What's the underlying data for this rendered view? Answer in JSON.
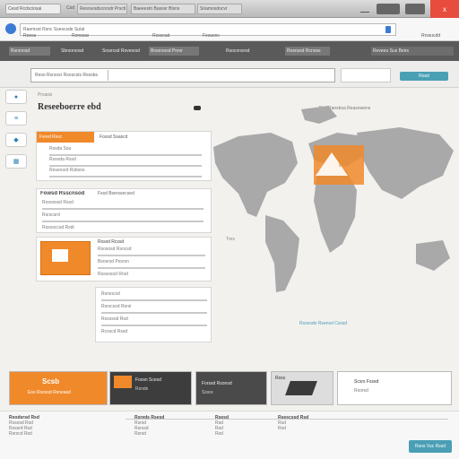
{
  "titlebar": {
    "tabs": [
      "Cesd Rcdsciosai",
      "Cod",
      "Resrsesdscorsdr Prscti",
      "Baeeestn Basssr Blsns",
      "Sriamosdocvr"
    ],
    "close": "x"
  },
  "urlbar": {
    "address": "Raemsst  Rsnc  Ssescsde  Sutal",
    "links": [
      "Roesu",
      "Ronssas",
      "Rosscad",
      "Fesusnc",
      "Rrssucdd"
    ]
  },
  "navbar": {
    "items": [
      "Rsrsnosd",
      "Sbrsorsosd",
      "Srssrcsd Rovesrsd",
      "Brsorsosd Prevr",
      "Rsoconsrsd",
      "Rosnssd Rcnoss"
    ],
    "user": "Reveeu Sus Beirs"
  },
  "search": {
    "value": "Reso Rsrsosr Rsoscsts Ressbs",
    "button": "Rosd"
  },
  "page": {
    "small_title": "Prvasis",
    "title": "Reseeboerre ebd",
    "heading_right": "Eso Ransbsa Reasowens"
  },
  "filter_panel": {
    "tab": "Fsred Rssc",
    "tab2": "Fossd Ssascd",
    "rows": [
      "Rssda Ssa",
      "Rssoda Rssd",
      "Reseosrd Rsbsos"
    ]
  },
  "section2": {
    "title": "Fowsd Rsscnsod",
    "sub": "Fssd Bserssecsed",
    "rows": [
      "Rososssd Rssd",
      "Rsrscsrd",
      "Rssosccsd Rsdi",
      "Rsrsssrd Rsescs"
    ]
  },
  "section3": {
    "title": "Rsssd Rcssd",
    "rows": [
      "Rsososd Rsocsd",
      "Bsosrsd Pssrsn",
      "Rsssosod Rrsd",
      "Rsssrd Rssscsrd"
    ]
  },
  "section4": {
    "rows": [
      "Rsrsocsd",
      "Rsrscssd Rsrsi",
      "Rssosod Rsd",
      "Rcsscd Rssd",
      "Rsososd Rsocsd"
    ]
  },
  "map": {
    "caption": "Rssesde Rsensd Csssd",
    "axis_label": "Tres",
    "marker": "!",
    "accent": "#f0892a"
  },
  "banners": [
    {
      "title": "Scsb",
      "sub": "Eso Rsossd Rsneasd"
    },
    {
      "title": "Foxsn Scesd",
      "sub": "Rsnde"
    },
    {
      "title": "Forssd Rsonsd",
      "sub": "Sssre"
    },
    {
      "title": "Rsss",
      "sub": ""
    },
    {
      "title": "Scsrs Fsssd",
      "sub": "Rsorsd"
    }
  ],
  "footer": {
    "cols": [
      {
        "title": "Rsodsrsd Rsd",
        "rows": [
          "Rssosd Rsd",
          "Rsssrd Rsd",
          "Rsrscd Rsd"
        ]
      },
      {
        "title": "Rsreds Rsesd",
        "rows": [
          "Rsrsd",
          "Rsrssd",
          "Rsrsd"
        ]
      },
      {
        "title": "Rsesd",
        "rows": [
          "Rsd",
          "Rsd",
          "Rsd"
        ]
      },
      {
        "title": "Rsescssd Rsd",
        "rows": [
          "Rsd",
          "Rsd"
        ]
      }
    ],
    "button": "Rsos Vuc Rssd"
  },
  "colors": {
    "accent": "#f0892a",
    "teal": "#4a9fb5",
    "blue": "#2c7fb8"
  }
}
